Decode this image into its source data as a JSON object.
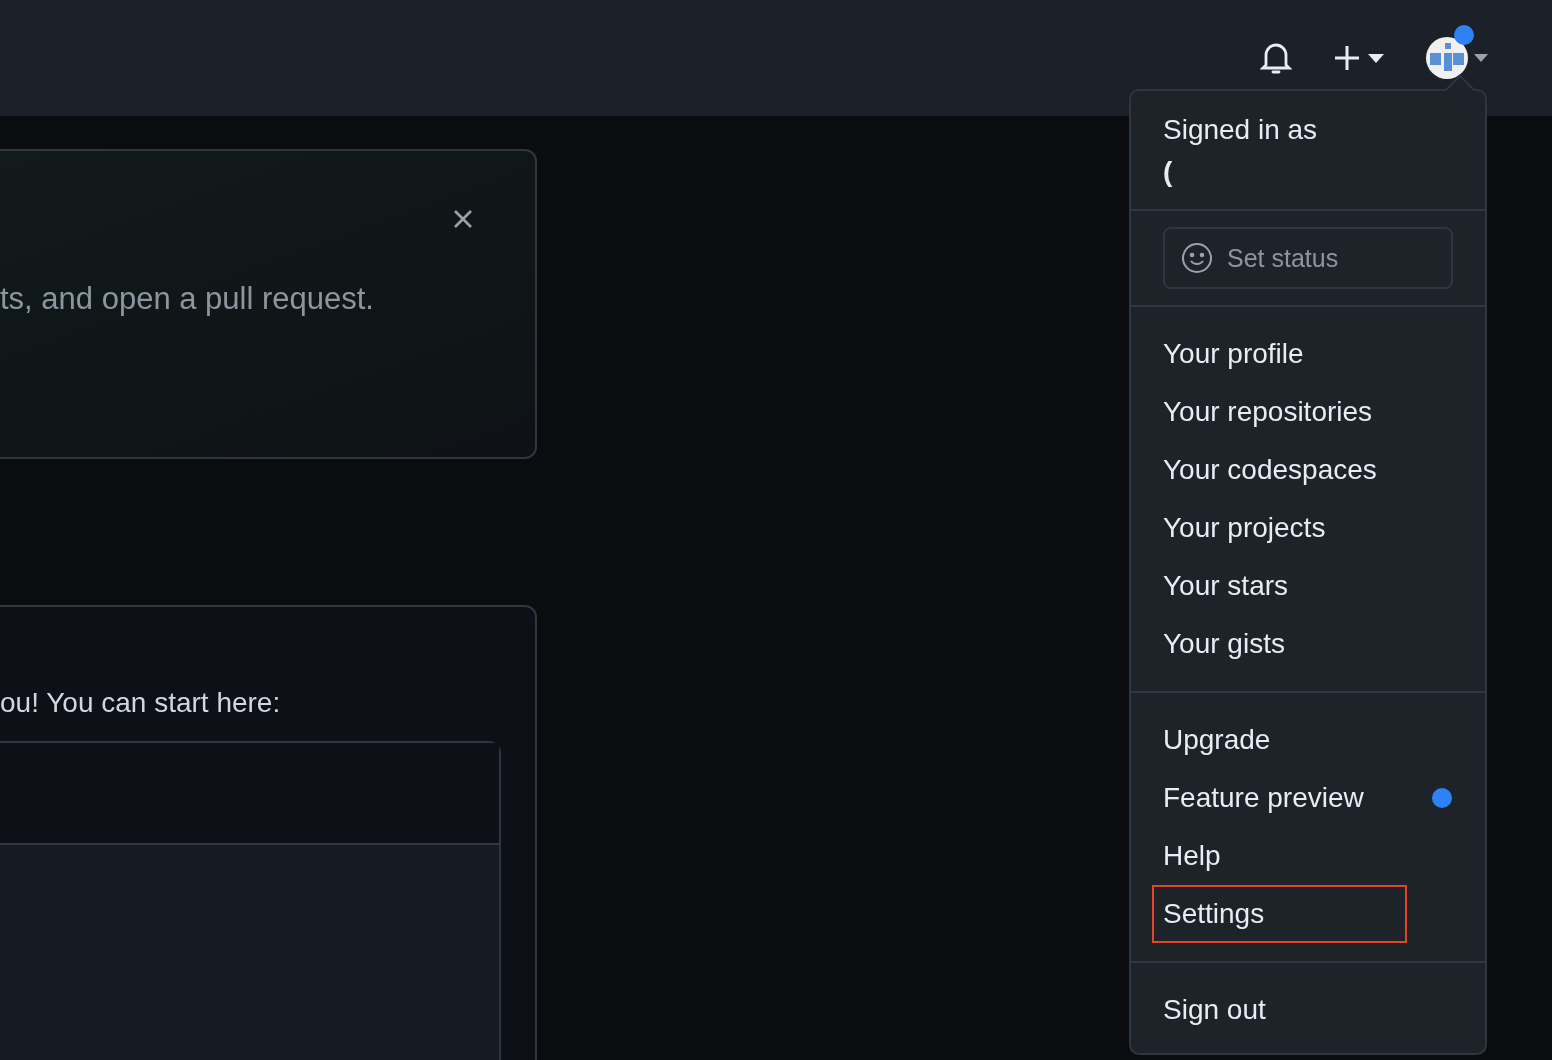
{
  "header": {
    "avatar_badge": true
  },
  "banner": {
    "text": "ts, and open a pull request."
  },
  "start_card": {
    "text": "ou! You can start here:"
  },
  "user_menu": {
    "signed_in_label": "Signed in as",
    "username": "(",
    "status": {
      "placeholder": "Set status"
    },
    "sections": [
      [
        {
          "label": "Your profile",
          "dot": false,
          "highlighted": false
        },
        {
          "label": "Your repositories",
          "dot": false,
          "highlighted": false
        },
        {
          "label": "Your codespaces",
          "dot": false,
          "highlighted": false
        },
        {
          "label": "Your projects",
          "dot": false,
          "highlighted": false
        },
        {
          "label": "Your stars",
          "dot": false,
          "highlighted": false
        },
        {
          "label": "Your gists",
          "dot": false,
          "highlighted": false
        }
      ],
      [
        {
          "label": "Upgrade",
          "dot": false,
          "highlighted": false
        },
        {
          "label": "Feature preview",
          "dot": true,
          "highlighted": false
        },
        {
          "label": "Help",
          "dot": false,
          "highlighted": false
        },
        {
          "label": "Settings",
          "dot": false,
          "highlighted": true
        }
      ],
      [
        {
          "label": "Sign out",
          "dot": false,
          "highlighted": false
        }
      ]
    ]
  }
}
